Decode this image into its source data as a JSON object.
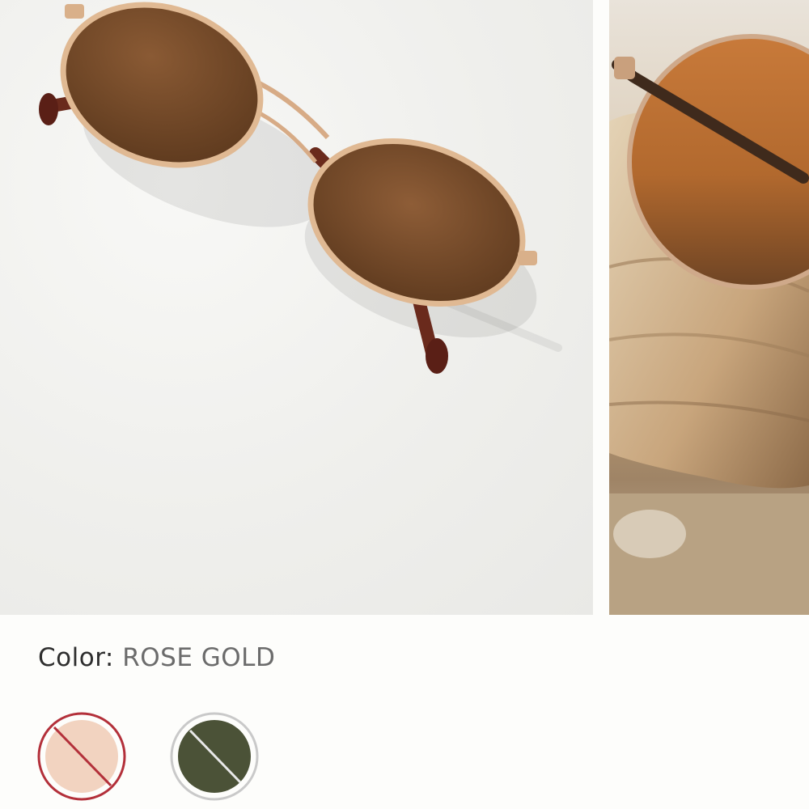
{
  "gallery": {
    "images": [
      {
        "name": "product-photo-flat-lay",
        "alt": "sunglasses"
      },
      {
        "name": "product-photo-on-shell",
        "alt": "sunglasses"
      }
    ]
  },
  "color_selector": {
    "label": "Color:",
    "selected_value": "ROSE GOLD",
    "swatches": [
      {
        "name": "rose-gold",
        "fill": "#f2d3c0",
        "ring": "#b3303a",
        "selected": true,
        "unavailable": true
      },
      {
        "name": "olive",
        "fill": "#4b5237",
        "ring": "#c9c9c9",
        "selected": false,
        "unavailable": true
      }
    ]
  },
  "colors": {
    "page_background": "#fdfdfb",
    "label_text": "#2e2e2e",
    "value_text": "#6b6b6b",
    "selected_ring": "#b3303a",
    "unselected_ring": "#c9c9c9"
  }
}
